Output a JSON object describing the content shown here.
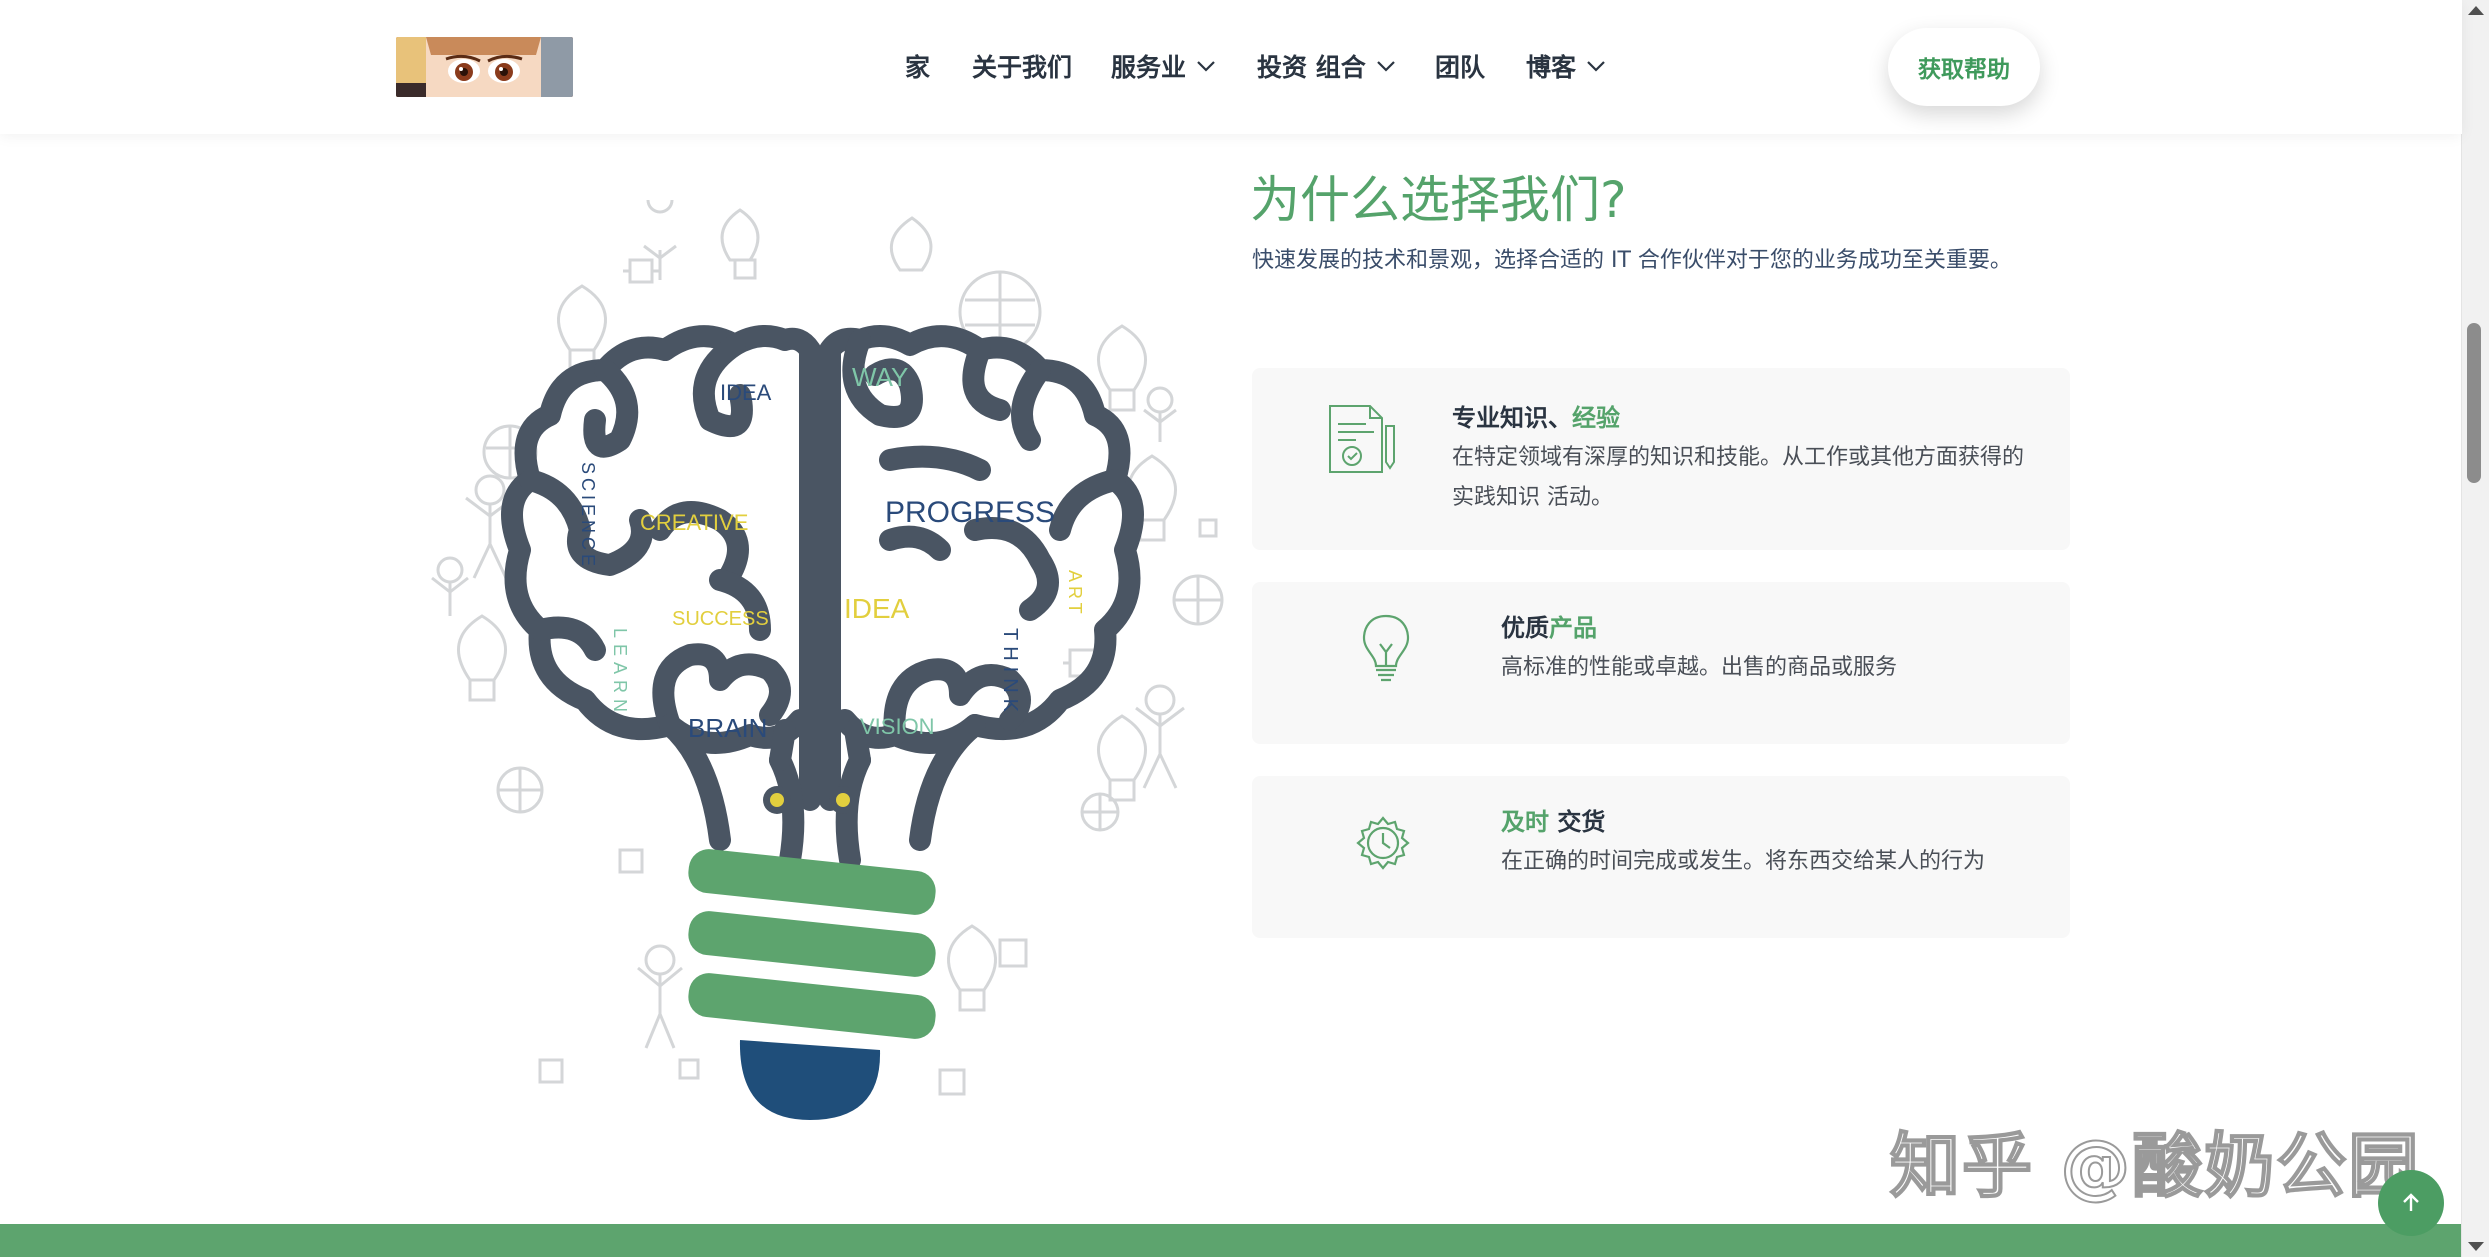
{
  "header": {
    "nav": [
      {
        "label": "家",
        "dropdown": false
      },
      {
        "label": "关于我们",
        "dropdown": false
      },
      {
        "label": "服务业",
        "dropdown": true
      },
      {
        "label": "投资 组合",
        "dropdown": true
      },
      {
        "label": "团队",
        "dropdown": false
      },
      {
        "label": "博客",
        "dropdown": true
      }
    ],
    "cta_label": "获取帮助"
  },
  "illustration": {
    "words": [
      "IDEA",
      "WAY",
      "SCIENCE",
      "CREATIVE",
      "PROGRESS",
      "SUCCESS",
      "IDEA",
      "ART",
      "LEARN",
      "BRAIN",
      "VISION",
      "THINK"
    ]
  },
  "section": {
    "title": "为什么选择我们?",
    "subtitle": "快速发展的技术和景观，选择合适的 IT 合作伙伴对于您的业务成功至关重要。"
  },
  "cards": [
    {
      "icon": "certificate-icon",
      "title_plain": "专业知识、",
      "title_highlight": "经验",
      "text": "在特定领域有深厚的知识和技能。从工作或其他方面获得的实践知识 活动。"
    },
    {
      "icon": "lightbulb-icon",
      "title_plain": "优质",
      "title_highlight": "产品",
      "text": "高标准的性能或卓越。出售的商品或服务"
    },
    {
      "icon": "gear-clock-icon",
      "title_highlight": "及时",
      "title_plain": " 交货",
      "text": "在正确的时间完成或发生。将东西交给某人的行为"
    }
  ],
  "watermark": "知乎 @酸奶公园",
  "colors": {
    "accent": "#55a36b",
    "dark": "#4a5563",
    "footer": "#5da46e",
    "base_blue": "#1f4e7a"
  }
}
